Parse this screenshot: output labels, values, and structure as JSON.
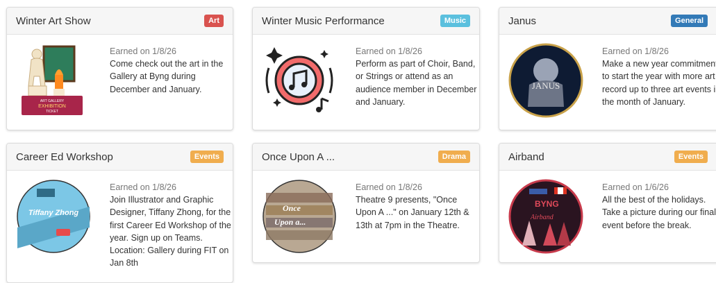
{
  "colors": {
    "art": "#d9534f",
    "music": "#5bc0de",
    "general": "#337ab7",
    "events": "#f0ad4e",
    "drama": "#f0ad4e"
  },
  "cards": [
    {
      "title": "Winter Art Show",
      "badge": "Art",
      "earned": "Earned on 1/8/26",
      "desc": "Come check out the art in the Gallery at Byng during December and January.",
      "image": "art-exhibition-illustration",
      "image_text": [
        "ART GALLERY",
        "EXHIBITION",
        "TICKET"
      ]
    },
    {
      "title": "Winter Music Performance",
      "badge": "Music",
      "earned": "Earned on 1/8/26",
      "desc": "Perform as part of Choir, Band, or Strings or attend as an audience member in December and January.",
      "image": "music-note-icon"
    },
    {
      "title": "Janus",
      "badge": "General",
      "earned": "Earned on 1/8/26",
      "desc": "Make a new year commitment to start the year with more art - record up to three art events in the month of January.",
      "image": "janus-statue-photo",
      "image_text": [
        "JANUS"
      ]
    },
    {
      "title": "Career Ed Workshop",
      "badge": "Events",
      "earned": "Earned on 1/8/26",
      "desc": "Join Illustrator and Graphic Designer, Tiffany Zhong, for the first Career Ed Workshop of the year. Sign up on Teams. Location: Gallery during FIT on Jan 8th",
      "image": "tiffany-zhong-illustration",
      "image_text": [
        "Tiffany Zhong"
      ]
    },
    {
      "title": "Once Upon A ...",
      "badge": "Drama",
      "earned": "Earned on 1/8/26",
      "desc": "Theatre 9 presents, \"Once Upon A ...\" on January 12th & 13th at 7pm in the Theatre.",
      "image": "once-upon-a-bookshelf-photo",
      "image_text": [
        "Once",
        "Upon a..."
      ]
    },
    {
      "title": "Airband",
      "badge": "Events",
      "earned": "Earned on 1/6/26",
      "desc": "All the best of the holidays. Take a picture during our final event before the break.",
      "image": "airband-stage-photo",
      "image_text": [
        "BYNG",
        "Airband"
      ]
    }
  ]
}
